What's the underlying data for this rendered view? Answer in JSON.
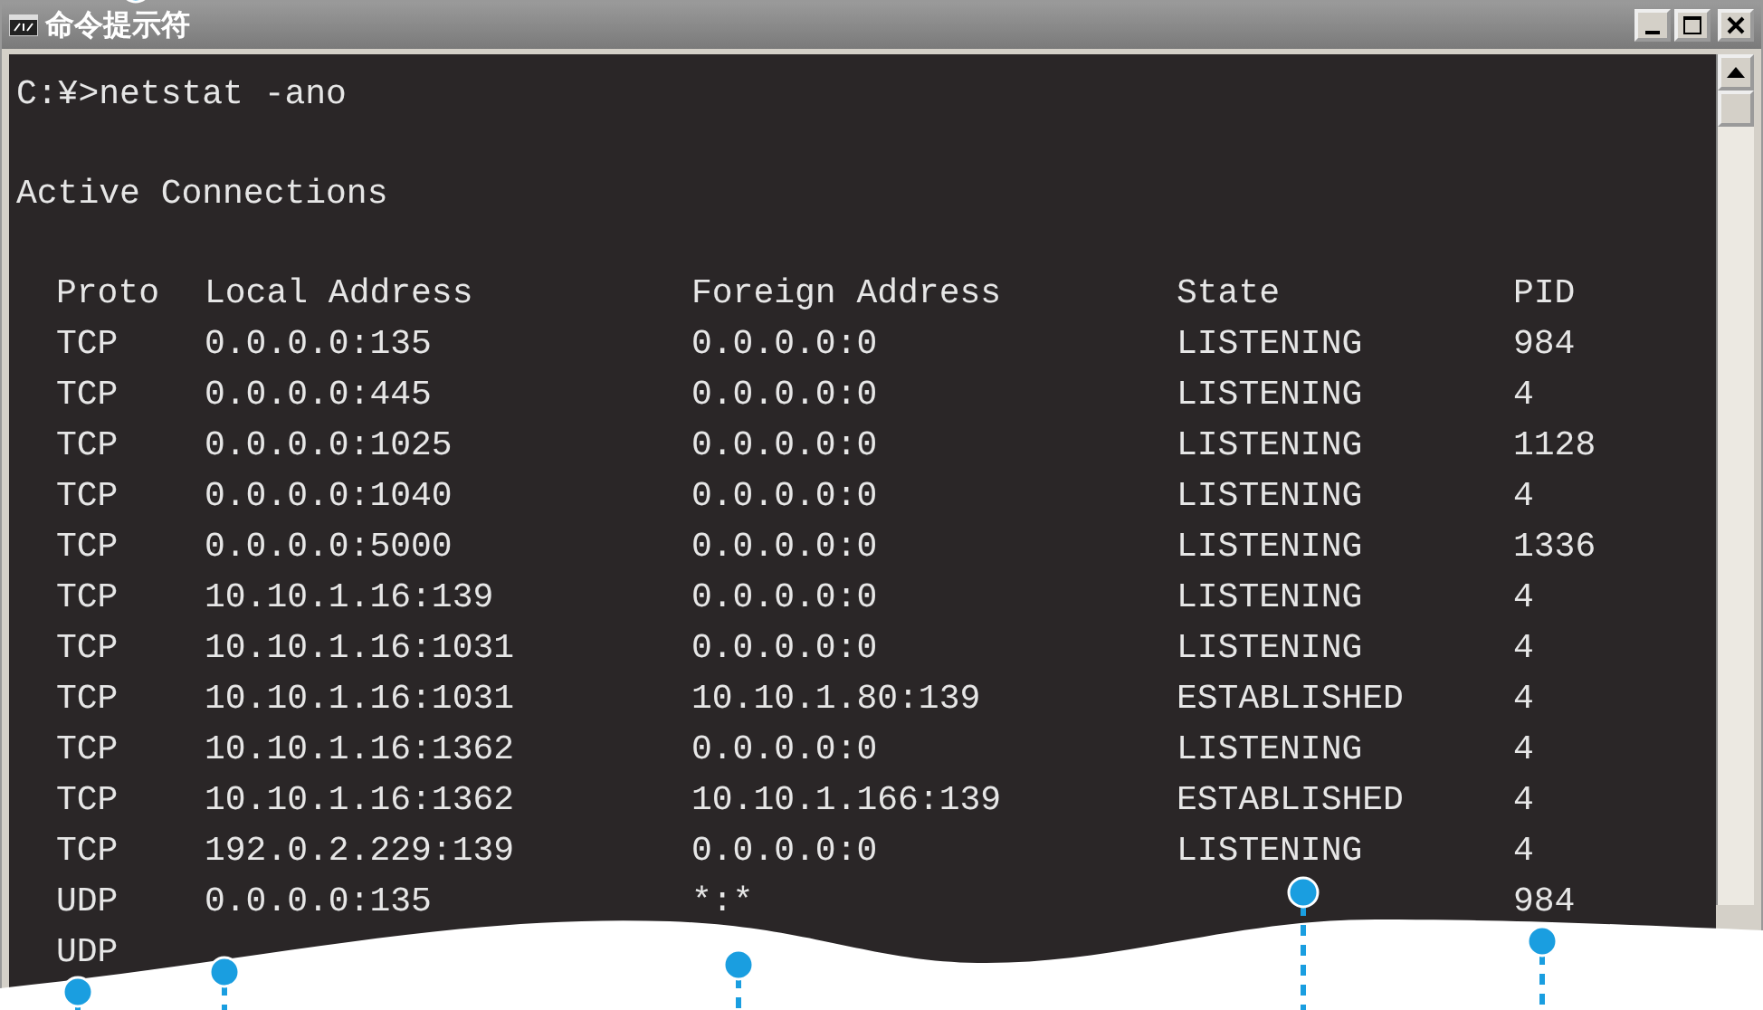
{
  "window": {
    "title": "命令提示符"
  },
  "console": {
    "command": "C:¥>netstat -ano",
    "heading": "Active Connections",
    "columns": [
      "Proto",
      "Local Address",
      "Foreign Address",
      "State",
      "PID"
    ],
    "rows": [
      {
        "cells": [
          "TCP",
          "0.0.0.0:135",
          "0.0.0.0:0",
          "LISTENING",
          "984"
        ]
      },
      {
        "cells": [
          "TCP",
          "0.0.0.0:445",
          "0.0.0.0:0",
          "LISTENING",
          "4"
        ]
      },
      {
        "cells": [
          "TCP",
          "0.0.0.0:1025",
          "0.0.0.0:0",
          "LISTENING",
          "1128"
        ]
      },
      {
        "cells": [
          "TCP",
          "0.0.0.0:1040",
          "0.0.0.0:0",
          "LISTENING",
          "4"
        ]
      },
      {
        "cells": [
          "TCP",
          "0.0.0.0:5000",
          "0.0.0.0:0",
          "LISTENING",
          "1336"
        ]
      },
      {
        "cells": [
          "TCP",
          "10.10.1.16:139",
          "0.0.0.0:0",
          "LISTENING",
          "4"
        ]
      },
      {
        "cells": [
          "TCP",
          "10.10.1.16:1031",
          "0.0.0.0:0",
          "LISTENING",
          "4"
        ]
      },
      {
        "cells": [
          "TCP",
          "10.10.1.16:1031",
          "10.10.1.80:139",
          "ESTABLISHED",
          "4"
        ]
      },
      {
        "cells": [
          "TCP",
          "10.10.1.16:1362",
          "0.0.0.0:0",
          "LISTENING",
          "4"
        ]
      },
      {
        "cells": [
          "TCP",
          "10.10.1.16:1362",
          "10.10.1.166:139",
          "ESTABLISHED",
          "4"
        ]
      },
      {
        "cells": [
          "TCP",
          "192.0.2.229:139",
          "0.0.0.0:0",
          "LISTENING",
          "4"
        ]
      },
      {
        "cells": [
          "UDP",
          "0.0.0.0:135",
          "*:*",
          "",
          "984"
        ]
      },
      {
        "cells": [
          "UDP"
        ]
      }
    ]
  }
}
